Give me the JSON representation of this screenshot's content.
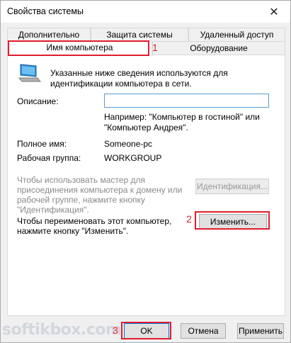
{
  "window": {
    "title": "Свойства системы"
  },
  "tabs": {
    "row1": [
      "Дополнительно",
      "Защита системы",
      "Удаленный доступ"
    ],
    "row2": [
      "Имя компьютера",
      "Оборудование"
    ]
  },
  "panel": {
    "info_line1": "Указанные ниже сведения используются для",
    "info_line2": "идентификации компьютера в сети.",
    "description_label": "Описание:",
    "description_value": "",
    "example_line1": "Например: \"Компьютер в гостиной\" или",
    "example_line2": "\"Компьютер Андрея\".",
    "fullname_label": "Полное имя:",
    "fullname_value": "Someone-pc",
    "workgroup_label": "Рабочая группа:",
    "workgroup_value": "WORKGROUP",
    "wizard_line1": "Чтобы использовать мастер для",
    "wizard_line2": "присоединения компьютера к домену или",
    "wizard_line3": "рабочей группе, нажмите кнопку",
    "wizard_line4": "\"Идентификация\".",
    "identify_button": "Идентификация...",
    "rename_line1": "Чтобы переименовать этот компьютер,",
    "rename_line2": "нажмите кнопку \"Изменить\".",
    "change_button": "Изменить..."
  },
  "footer": {
    "ok_button": "OK",
    "cancel_button": "Отмена",
    "apply_button": "Применить"
  },
  "annotations": {
    "marker1": "1",
    "marker2": "2",
    "marker3": "3"
  },
  "watermark": {
    "text": "softikbox.com"
  },
  "colors": {
    "highlight": "#e01e2f",
    "focus_border": "#0078d7"
  }
}
